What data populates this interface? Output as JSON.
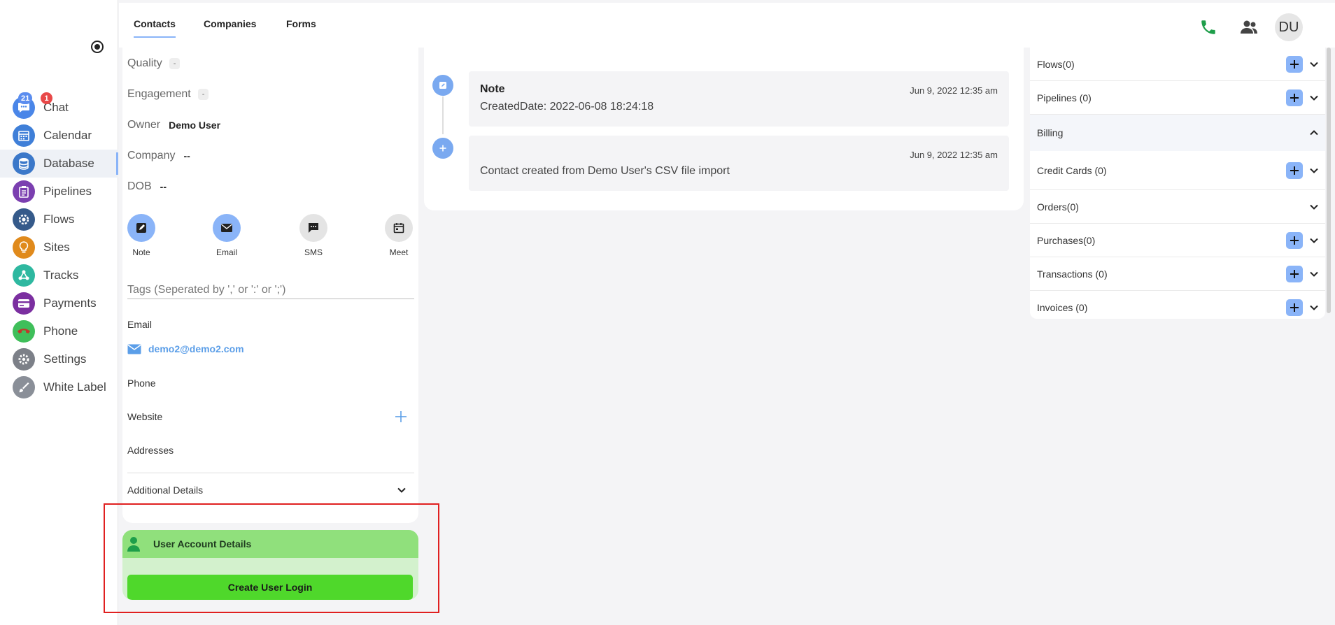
{
  "sidebar": {
    "items": [
      {
        "label": "Chat",
        "icon": "chat-icon",
        "color": "#4a86e8",
        "badge_blue": "21",
        "badge_red": "1"
      },
      {
        "label": "Calendar",
        "icon": "calendar-icon",
        "color": "#3f7fd8"
      },
      {
        "label": "Database",
        "icon": "database-icon",
        "color": "#3b78c9"
      },
      {
        "label": "Pipelines",
        "icon": "clipboard-icon",
        "color": "#7b3fb0"
      },
      {
        "label": "Flows",
        "icon": "gear-icon",
        "color": "#355a8a"
      },
      {
        "label": "Sites",
        "icon": "bulb-icon",
        "color": "#e08a1c"
      },
      {
        "label": "Tracks",
        "icon": "network-icon",
        "color": "#2eb8a0"
      },
      {
        "label": "Payments",
        "icon": "card-icon",
        "color": "#7b2fa0"
      },
      {
        "label": "Phone",
        "icon": "phone-icon",
        "color": "#3fbf5a"
      },
      {
        "label": "Settings",
        "icon": "cog-icon",
        "color": "#7c8088"
      },
      {
        "label": "White Label",
        "icon": "brush-icon",
        "color": "#8a8f98"
      }
    ]
  },
  "topbar": {
    "tabs": [
      "Contacts",
      "Companies",
      "Forms"
    ],
    "avatar_initials": "DU"
  },
  "contact": {
    "fields": [
      {
        "label": "Quality",
        "chip": "-"
      },
      {
        "label": "Engagement",
        "chip": "-"
      },
      {
        "label": "Owner",
        "value": "Demo User"
      },
      {
        "label": "Company",
        "value": "--"
      },
      {
        "label": "DOB",
        "value": "--"
      }
    ],
    "actions": [
      "Note",
      "Email",
      "SMS",
      "Meet"
    ],
    "tags_placeholder": "Tags (Seperated by ',' or ':' or ';')",
    "email_label": "Email",
    "email_value": "demo2@demo2.com",
    "phone_label": "Phone",
    "website_label": "Website",
    "addresses_label": "Addresses",
    "additional_details_label": "Additional Details"
  },
  "user_account": {
    "title": "User Account Details",
    "button_label": "Create User Login"
  },
  "timeline": [
    {
      "title": "Note",
      "date": "Jun 9, 2022 12:35 am",
      "body": "CreatedDate: 2022-06-08 18:24:18"
    },
    {
      "title": "",
      "date": "Jun 9, 2022 12:35 am",
      "body": "Contact created from Demo User's CSV file import"
    }
  ],
  "right_panel": {
    "rows": [
      {
        "label": "Flows(0)",
        "add": true
      },
      {
        "label": "Pipelines (0)",
        "add": true
      },
      {
        "label": "Billing",
        "add": false
      },
      {
        "label": "Credit Cards (0)",
        "add": true
      },
      {
        "label": "Orders(0)",
        "add": false
      },
      {
        "label": "Purchases(0)",
        "add": true
      },
      {
        "label": "Transactions (0)",
        "add": true
      },
      {
        "label": "Invoices (0)",
        "add": true
      }
    ]
  }
}
